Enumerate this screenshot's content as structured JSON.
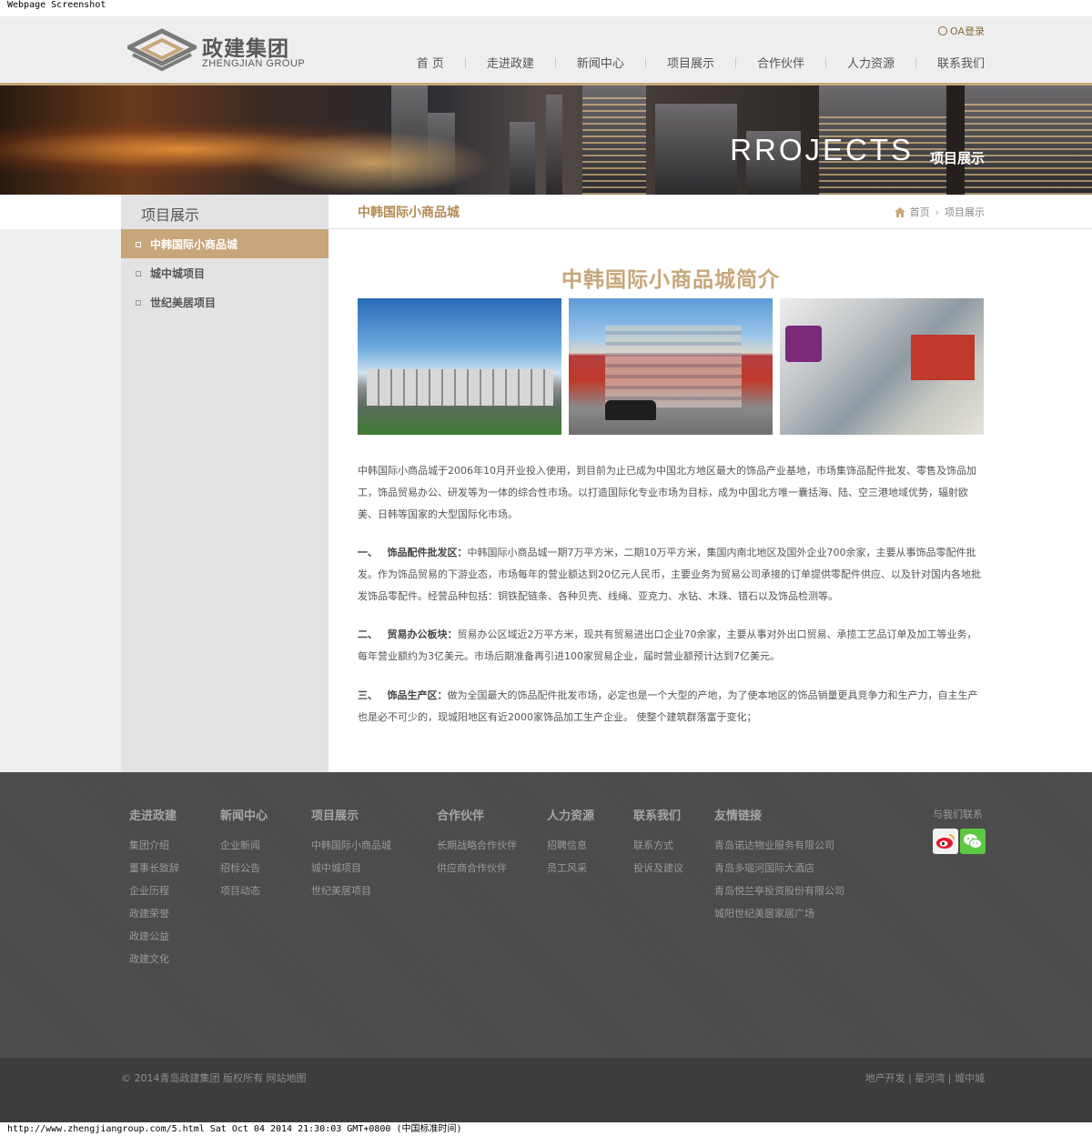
{
  "capture": {
    "top_label": "Webpage Screenshot",
    "bottom_label": "http://www.zhengjiangroup.com/5.html Sat Oct 04 2014 21:30:03 GMT+0800 (中国标准时间)"
  },
  "header": {
    "logo_cn": "政建集团",
    "logo_en": "ZHENGJIAN GROUP",
    "oa_login": "OA登录",
    "nav": [
      "首 页",
      "走进政建",
      "新闻中心",
      "项目展示",
      "合作伙伴",
      "人力资源",
      "联系我们"
    ]
  },
  "banner": {
    "title_en": "RROJECTS",
    "title_cn": "项目展示"
  },
  "sidebar": {
    "title": "项目展示",
    "items": [
      "中韩国际小商品城",
      "城中城项目",
      "世纪美居项目"
    ],
    "active": 0
  },
  "content": {
    "heading": "中韩国际小商品城",
    "breadcrumb": [
      "首页",
      "项目展示"
    ],
    "article_title": "中韩国际小商品城简介",
    "intro": "中韩国际小商品城于2006年10月开业投入使用，到目前为止已成为中国北方地区最大的饰品产业基地，市场集饰品配件批发、零售及饰品加工，饰品贸易办公、研发等为一体的综合性市场。以打造国际化专业市场为目标，成为中国北方唯一囊括海、陆、空三港地域优势，辐射欧美、日韩等国家的大型国际化市场。",
    "sections": [
      {
        "num": "一、",
        "label": "饰品配件批发区：",
        "text": "中韩国际小商品城一期7万平方米，二期10万平方米，集国内南北地区及国外企业700余家，主要从事饰品零配件批发。作为饰品贸易的下游业态，市场每年的营业额达到20亿元人民币，主要业务为贸易公司承接的订单提供零配件供应、以及针对国内各地批发饰品零配件。经营品种包括：铜铁配链条、各种贝壳、线绳、亚克力、水钻、木珠、错石以及饰品检测等。"
      },
      {
        "num": "二、",
        "label": "贸易办公板块：",
        "text": "贸易办公区域近2万平方米，现共有贸易进出口企业70余家，主要从事对外出口贸易、承揽工艺品订单及加工等业务，每年营业额约为3亿美元。市场后期准备再引进100家贸易企业，届时营业额预计达到7亿美元。"
      },
      {
        "num": "三、",
        "label": "饰品生产区：",
        "text": "做为全国最大的饰品配件批发市场，必定也是一个大型的产地，为了使本地区的饰品销量更具竞争力和生产力，自主生产也是必不可少的，现城阳地区有近2000家饰品加工生产企业。 使整个建筑群落富于变化；"
      }
    ]
  },
  "footer": {
    "columns": [
      {
        "title": "走进政建",
        "links": [
          "集团介绍",
          "董事长致辞",
          "企业历程",
          "政建荣誉",
          "政建公益",
          "政建文化"
        ]
      },
      {
        "title": "新闻中心",
        "links": [
          "企业新闻",
          "招标公告",
          "项目动态"
        ]
      },
      {
        "title": "项目展示",
        "links": [
          "中韩国际小商品城",
          "城中城项目",
          "世纪美居项目"
        ]
      },
      {
        "title": "合作伙伴",
        "links": [
          "长期战略合作伙伴",
          "供应商合作伙伴"
        ]
      },
      {
        "title": "人力资源",
        "links": [
          "招聘信息",
          "员工风采"
        ]
      },
      {
        "title": "联系我们",
        "links": [
          "联系方式",
          "投诉及建议"
        ]
      },
      {
        "title": "友情链接",
        "links": [
          "青岛诺达物业服务有限公司",
          "青岛多瑙河国际大酒店",
          "青岛悦兰亭投资股份有限公司",
          "城阳世纪美居家居广场"
        ]
      }
    ],
    "contact_label": "与我们联系",
    "copyright": "© 2014青岛政建集团 版权所有",
    "sitemap": "网站地图",
    "bottom_links": [
      "地产开发",
      "星河湾",
      "城中城"
    ],
    "accent": "#c7a67a"
  }
}
